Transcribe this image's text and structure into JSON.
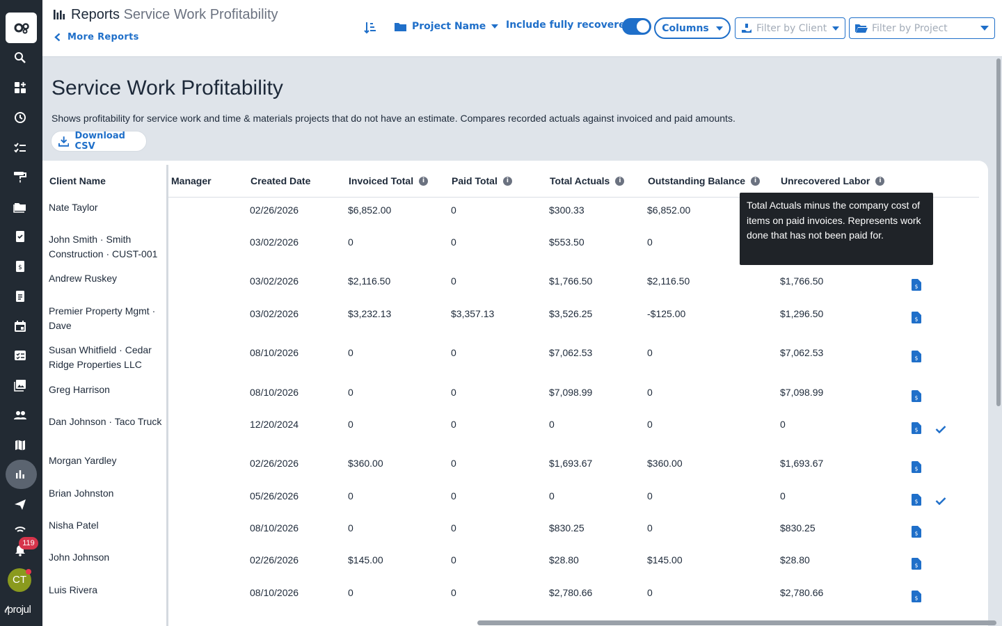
{
  "header": {
    "title": "Reports",
    "subtitle": "Service Work Profitability",
    "more_reports": "More Reports",
    "group_by": "Project Name",
    "include_label": "Include fully recovered",
    "columns_label": "Columns",
    "filter_client_placeholder": "Filter by Client",
    "filter_project_placeholder": "Filter by Project"
  },
  "page": {
    "title": "Service Work Profitability",
    "description": "Shows profitability for service work and time & materials projects that do not have an estimate. Compares recorded actuals against invoiced and paid amounts.",
    "download_label": "Download CSV"
  },
  "nav": {
    "badge_count": "119",
    "avatar_initials": "CT",
    "brand": "projul"
  },
  "table": {
    "columns": [
      "Client Name",
      "ject Manager",
      "Created Date",
      "Invoiced Total",
      "Paid Total",
      "Total Actuals",
      "Outstanding Balance",
      "Unrecovered Labor"
    ],
    "rows": [
      {
        "client": "Nate Taylor",
        "created": "02/26/2026",
        "invoiced": "$6,852.00",
        "paid": "0",
        "actuals": "$300.33",
        "outstanding": "$6,852.00",
        "unrecovered": "",
        "doc": false,
        "check": false
      },
      {
        "client": "John Smith · Smith Construction · CUST-001",
        "created": "03/02/2026",
        "invoiced": "0",
        "paid": "0",
        "actuals": "$553.50",
        "outstanding": "0",
        "unrecovered": "",
        "doc": false,
        "check": false
      },
      {
        "client": "Andrew Ruskey",
        "created": "03/02/2026",
        "invoiced": "$2,116.50",
        "paid": "0",
        "actuals": "$1,766.50",
        "outstanding": "$2,116.50",
        "unrecovered": "$1,766.50",
        "doc": true,
        "check": false
      },
      {
        "client": "Premier Property Mgmt · Dave",
        "created": "03/02/2026",
        "invoiced": "$3,232.13",
        "paid": "$3,357.13",
        "actuals": "$3,526.25",
        "outstanding": "-$125.00",
        "unrecovered": "$1,296.50",
        "doc": true,
        "check": false
      },
      {
        "client": "Susan Whitfield · Cedar Ridge Properties LLC",
        "created": "08/10/2026",
        "invoiced": "0",
        "paid": "0",
        "actuals": "$7,062.53",
        "outstanding": "0",
        "unrecovered": "$7,062.53",
        "doc": true,
        "check": false
      },
      {
        "client": "Greg Harrison",
        "created": "08/10/2026",
        "invoiced": "0",
        "paid": "0",
        "actuals": "$7,098.99",
        "outstanding": "0",
        "unrecovered": "$7,098.99",
        "doc": true,
        "check": false
      },
      {
        "client": "Dan Johnson · Taco Truck",
        "created": "12/20/2024",
        "invoiced": "0",
        "paid": "0",
        "actuals": "0",
        "outstanding": "0",
        "unrecovered": "0",
        "doc": true,
        "check": true
      },
      {
        "client": "Morgan Yardley",
        "created": "02/26/2026",
        "invoiced": "$360.00",
        "paid": "0",
        "actuals": "$1,693.67",
        "outstanding": "$360.00",
        "unrecovered": "$1,693.67",
        "doc": true,
        "check": false
      },
      {
        "client": "Brian Johnston",
        "created": "05/26/2026",
        "invoiced": "0",
        "paid": "0",
        "actuals": "0",
        "outstanding": "0",
        "unrecovered": "0",
        "doc": true,
        "check": true
      },
      {
        "client": "Nisha Patel",
        "created": "08/10/2026",
        "invoiced": "0",
        "paid": "0",
        "actuals": "$830.25",
        "outstanding": "0",
        "unrecovered": "$830.25",
        "doc": true,
        "check": false
      },
      {
        "client": "John Johnson",
        "created": "02/26/2026",
        "invoiced": "$145.00",
        "paid": "0",
        "actuals": "$28.80",
        "outstanding": "$145.00",
        "unrecovered": "$28.80",
        "doc": true,
        "check": false
      },
      {
        "client": "Luis Rivera",
        "created": "08/10/2026",
        "invoiced": "0",
        "paid": "0",
        "actuals": "$2,780.66",
        "outstanding": "0",
        "unrecovered": "$2,780.66",
        "doc": true,
        "check": false
      }
    ]
  },
  "tooltip": {
    "text": "Total Actuals minus the company cost of items on paid invoices. Represents work done that has not been paid for."
  },
  "colors": {
    "accent": "#1f6fc9",
    "rail": "#222a33",
    "background": "#dfe4ea"
  }
}
